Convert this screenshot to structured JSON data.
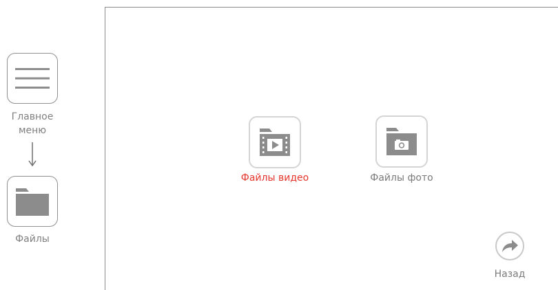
{
  "sidebar": {
    "main_menu": {
      "label_line1": "Главное",
      "label_line2": "меню",
      "icon": "hamburger-menu-icon"
    },
    "files": {
      "label": "Файлы",
      "icon": "folder-icon"
    }
  },
  "screen": {
    "video_files": {
      "label": "Файлы видео",
      "icon": "video-folder-icon",
      "label_color": "#e5342b",
      "selected": true
    },
    "photo_files": {
      "label": "Файлы фото",
      "icon": "photo-folder-icon",
      "label_color": "#7a7a7a"
    },
    "back": {
      "label": "Назад",
      "icon": "back-arrow-icon"
    }
  },
  "colors": {
    "icon_gray": "#8c8c8c",
    "accent": "#e5342b"
  }
}
